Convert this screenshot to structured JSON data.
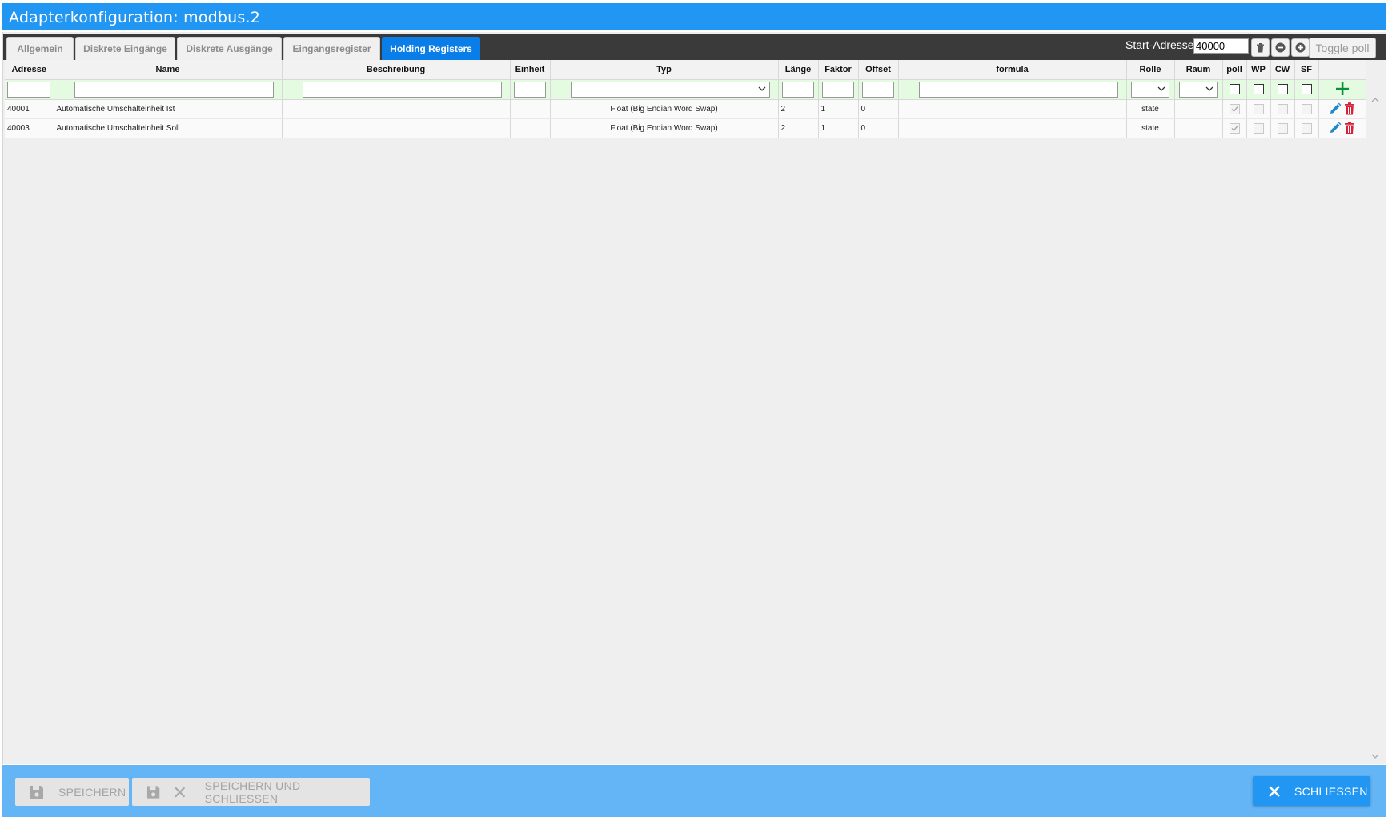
{
  "title": "Adapterkonfiguration: modbus.2",
  "tabs": [
    {
      "label": "Allgemein"
    },
    {
      "label": "Diskrete Eingänge"
    },
    {
      "label": "Diskrete Ausgänge"
    },
    {
      "label": "Eingangsregister"
    },
    {
      "label": "Holding Registers",
      "active": true
    }
  ],
  "toolbar": {
    "start_address_label": "Start-Adresse:",
    "start_address_value": "40000",
    "toggle_poll_label": "Toggle poll"
  },
  "columns": [
    "Adresse",
    "Name",
    "Beschreibung",
    "Einheit",
    "Typ",
    "Länge",
    "Faktor",
    "Offset",
    "formula",
    "Rolle",
    "Raum",
    "poll",
    "WP",
    "CW",
    "SF",
    ""
  ],
  "rows": [
    {
      "address": "40001",
      "name": "Automatische Umschalteinheit Ist",
      "description": "",
      "unit": "",
      "type": "Float (Big Endian Word Swap)",
      "length": "2",
      "factor": "1",
      "offset": "0",
      "formula": "",
      "role": "state",
      "room": "",
      "poll": true,
      "wp": false,
      "cw": false,
      "sf": false
    },
    {
      "address": "40003",
      "name": "Automatische Umschalteinheit Soll",
      "description": "",
      "unit": "",
      "type": "Float (Big Endian Word Swap)",
      "length": "2",
      "factor": "1",
      "offset": "0",
      "formula": "",
      "role": "state",
      "room": "",
      "poll": true,
      "wp": false,
      "cw": false,
      "sf": false
    }
  ],
  "footer": {
    "save_label": "SPEICHERN",
    "save_close_label": "SPEICHERN UND SCHLIESSEN",
    "close_label": "SCHLIESSEN"
  },
  "colors": {
    "header_blue": "#2196f3",
    "tab_active": "#0a7ee8",
    "footer_blue": "#64b5f6",
    "filter_row": "#e5fbe1",
    "add_green": "#0a8f3c",
    "edit_blue": "#1e88c8",
    "delete_red": "#d8203a"
  }
}
